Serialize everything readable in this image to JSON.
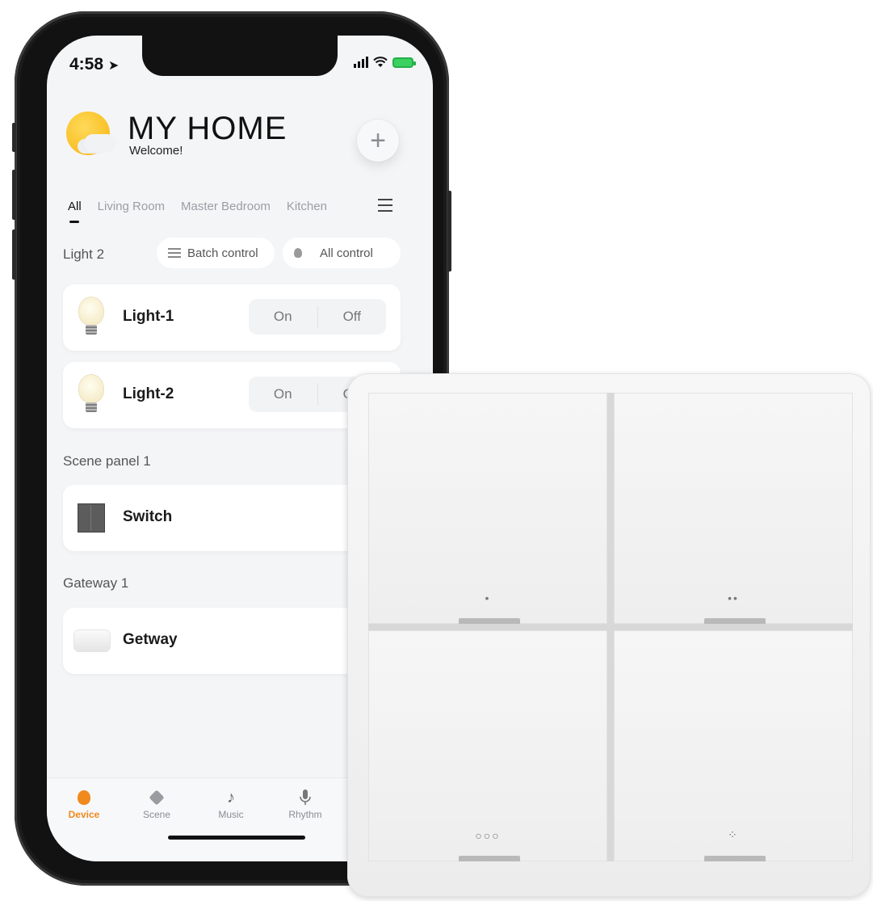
{
  "status_bar": {
    "time": "4:58",
    "location_arrow": "➤",
    "wifi_icon": "wifi-icon",
    "battery_color": "#3bd15f"
  },
  "header": {
    "title": "MY HOME",
    "subtitle": "Welcome!",
    "add_button": "+"
  },
  "tabs": [
    "All",
    "Living Room",
    "Master Bedroom",
    "Kitchen"
  ],
  "active_tab": "All",
  "light_group": {
    "label": "Light 2",
    "batch_control": "Batch control",
    "all_control": "All control",
    "devices": [
      {
        "name": "Light-1",
        "on_label": "On",
        "off_label": "Off"
      },
      {
        "name": "Light-2",
        "on_label": "On",
        "off_label": "Off"
      }
    ]
  },
  "scene_group": {
    "label": "Scene panel 1",
    "devices": [
      {
        "name": "Switch"
      }
    ]
  },
  "gateway_group": {
    "label": "Gateway 1",
    "devices": [
      {
        "name": "Getway"
      }
    ]
  },
  "bottom_nav": {
    "items": [
      {
        "label": "Device",
        "icon": "bulb-icon",
        "active": true
      },
      {
        "label": "Scene",
        "icon": "cube-icon",
        "active": false
      },
      {
        "label": "Music",
        "icon": "music-note-icon",
        "active": false
      },
      {
        "label": "Rhythm",
        "icon": "microphone-icon",
        "active": false
      }
    ],
    "active_color": "#f08a1e"
  },
  "wall_switch": {
    "keys": [
      {
        "mark": "•"
      },
      {
        "mark": "••"
      },
      {
        "mark": "○○○"
      },
      {
        "mark": "⁘"
      }
    ]
  },
  "colors": {
    "accent": "#f08a1e",
    "screen_bg": "#f4f5f7",
    "phone_frame": "#121212"
  }
}
